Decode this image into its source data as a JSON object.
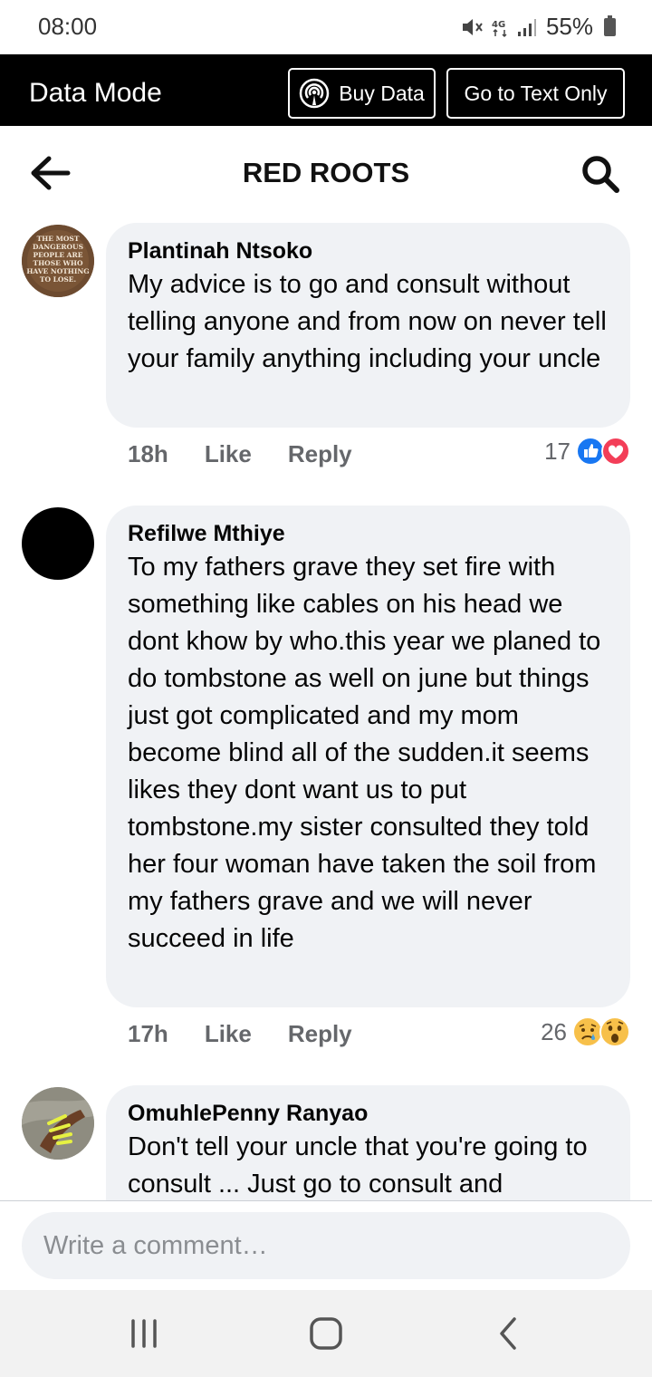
{
  "status_bar": {
    "time": "08:00",
    "network": "4G",
    "battery": "55%"
  },
  "data_mode_bar": {
    "title": "Data Mode",
    "buy_data_label": "Buy Data",
    "text_only_label": "Go to Text Only"
  },
  "header": {
    "title": "RED ROOTS"
  },
  "avatar_texts": {
    "plantinah": "THE MOST DANGEROUS PEOPLE ARE THOSE WHO HAVE NOTHING TO LOSE."
  },
  "comments": [
    {
      "author": "Plantinah Ntsoko",
      "text": "My advice is to go and consult without telling anyone and from now on never tell your family anything including your uncle",
      "time": "18h",
      "like_label": "Like",
      "reply_label": "Reply",
      "reaction_count": "17",
      "reactions": [
        "like-icon",
        "love-icon"
      ]
    },
    {
      "author": "Refilwe Mthiye",
      "text": "To my fathers grave they set fire with something like cables on his head we dont khow by who.this year we planed to do tombstone as well on june but things just got complicated and my mom become blind all of the sudden.it seems likes they dont want us to put tombstone.my sister consulted they told her four woman have taken the soil from my fathers grave and we will never succeed in life",
      "time": "17h",
      "like_label": "Like",
      "reply_label": "Reply",
      "reaction_count": "26",
      "reactions": [
        "sad-icon",
        "wow-icon"
      ]
    },
    {
      "author": "OmuhlePenny Ranyao",
      "text": "Don't tell your uncle that you're going to consult ... Just go to consult and"
    }
  ],
  "composer": {
    "placeholder": "Write a comment…"
  },
  "colors": {
    "data_bar_bg": "#000000",
    "bubble_bg": "#f0f2f5",
    "like_blue": "#1877f2",
    "love_red": "#f33e58",
    "meta_gray": "#65676b"
  }
}
